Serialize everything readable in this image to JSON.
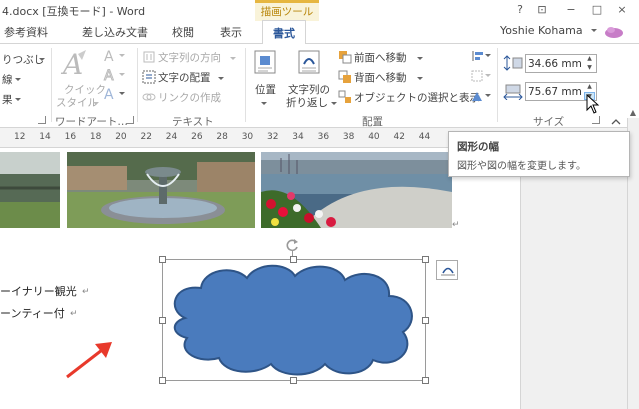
{
  "window": {
    "title": "4.docx [互換モード] - Word",
    "context_group": "描画ツール",
    "controls": [
      "?",
      "⊡",
      "−",
      "□",
      "×"
    ]
  },
  "tabs": [
    {
      "label": "参考資料"
    },
    {
      "label": "差し込み文書"
    },
    {
      "label": "校閲"
    },
    {
      "label": "表示"
    },
    {
      "label": "書式",
      "active": true
    }
  ],
  "user": {
    "name": "Yoshie Kohama"
  },
  "ribbon": {
    "left_items": [
      "りつぶし",
      "線",
      "果"
    ],
    "wordart": {
      "quick_styles": [
        "クイック",
        "スタイル"
      ],
      "group_label": "ワードアート…"
    },
    "text_group": {
      "items": [
        "文字列の方向",
        "文字の配置",
        "リンクの作成"
      ],
      "label": "テキスト"
    },
    "arrange_group": {
      "position": "位置",
      "wrap": [
        "文字列の",
        "折り返し"
      ],
      "front": "前面へ移動",
      "back": "背面へ移動",
      "select_pane": "オブジェクトの選択と表示",
      "label": "配置"
    },
    "size_group": {
      "height": "34.66 mm",
      "width": "75.67 mm",
      "label": "サイズ"
    }
  },
  "ruler": {
    "numbers": [
      "12",
      "14",
      "16",
      "18",
      "20",
      "22",
      "24",
      "26",
      "28",
      "30",
      "32",
      "34",
      "36",
      "38",
      "40",
      "42",
      "44"
    ]
  },
  "tooltip": {
    "title": "図形の幅",
    "description": "図形や図の幅を変更します。"
  },
  "document": {
    "lines": [
      "ーイナリー観光",
      "ーンティー付"
    ],
    "para_mark": "↵"
  },
  "colors": {
    "accent": "#2b579a",
    "context": "#e6b640",
    "shape_fill": "#4a7bbd",
    "shape_stroke": "#2e5487",
    "arrow": "#e8392b"
  }
}
